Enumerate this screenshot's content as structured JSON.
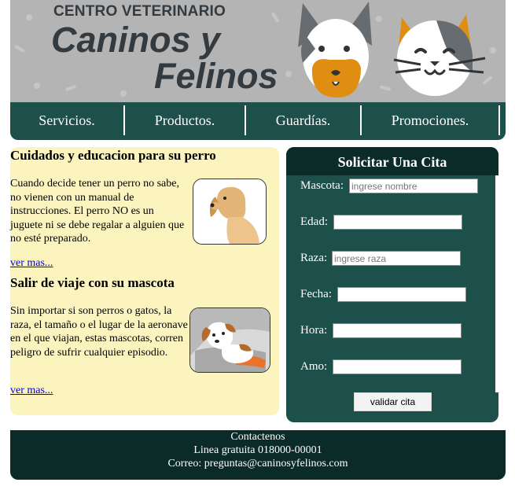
{
  "header": {
    "brand_small": "CENTRO VETERINARIO",
    "brand_line1": "Caninos y",
    "brand_line2": "Felinos"
  },
  "nav": {
    "items": [
      "Servicios.",
      "Productos.",
      "Guardías.",
      "Promociones."
    ]
  },
  "articles": [
    {
      "title": "Cuidados y educacion para su perro",
      "text": "Cuando decide tener un perro no sabe, no vienen con un manual de instrucciones. El perro NO es un juguete ni se debe regalar a alguien que no esté preparado.",
      "link": "ver mas..."
    },
    {
      "title": "Salir de viaje con su mascota",
      "text": "Sin importar si son perros o gatos, la raza, el tamaño o el lugar de la aeronave en el que viajan, estas mascotas, corren peligro de sufrir cualquier episodio.",
      "link": "ver mas..."
    }
  ],
  "form": {
    "title": "Solicitar Una Cita",
    "fields": [
      {
        "label": "Mascota:",
        "placeholder": "ingrese nombre",
        "value": ""
      },
      {
        "label": "Edad:",
        "placeholder": "",
        "value": ""
      },
      {
        "label": "Raza:",
        "placeholder": "ingrese raza",
        "value": ""
      },
      {
        "label": "Fecha:",
        "placeholder": "",
        "value": ""
      },
      {
        "label": "Hora:",
        "placeholder": "",
        "value": ""
      },
      {
        "label": "Amo:",
        "placeholder": "",
        "value": ""
      }
    ],
    "submit_label": "validar cita"
  },
  "footer": {
    "line1": "Contactenos",
    "line2": "Linea gratuita 018000-00001",
    "line3": "Correo: preguntas@caninosyfelinos.com"
  },
  "colors": {
    "nav_bg": "#1d4f4b",
    "header_bar": "#0b2b29",
    "article_bg": "#fbf4bf",
    "banner_bg": "#b4b4b4"
  }
}
